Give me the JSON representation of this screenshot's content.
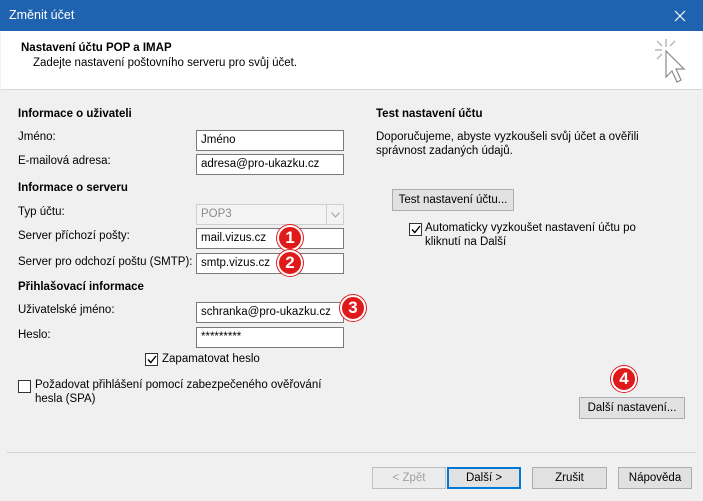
{
  "window": {
    "title": "Změnit účet"
  },
  "header": {
    "title": "Nastavení účtu POP a IMAP",
    "subtitle": "Zadejte nastavení poštovního serveru pro svůj účet."
  },
  "user_info": {
    "heading": "Informace o uživateli",
    "name_label": "Jméno:",
    "name_value": "Jméno",
    "email_label": "E-mailová adresa:",
    "email_value": "adresa@pro-ukazku.cz"
  },
  "server_info": {
    "heading": "Informace o serveru",
    "account_type_label": "Typ účtu:",
    "account_type_value": "POP3",
    "incoming_label": "Server příchozí pošty:",
    "incoming_value": "mail.vizus.cz",
    "outgoing_label": "Server pro odchozí poštu (SMTP):",
    "outgoing_value": "smtp.vizus.cz"
  },
  "login_info": {
    "heading": "Přihlašovací informace",
    "username_label": "Uživatelské jméno:",
    "username_value": "schranka@pro-ukazku.cz",
    "password_label": "Heslo:",
    "password_value": "*********",
    "remember_label": "Zapamatovat heslo",
    "remember_checked": true,
    "spa_label_line1": "Požadovat přihlášení pomocí zabezpečeného ověřování",
    "spa_label_line2": "hesla (SPA)",
    "spa_checked": false
  },
  "test_section": {
    "heading": "Test nastavení účtu",
    "desc_line1": "Doporučujeme, abyste vyzkoušeli svůj účet a ověřili",
    "desc_line2": "správnost zadaných údajů.",
    "test_button": "Test nastavení účtu...",
    "auto_test_line1": "Automaticky vyzkoušet nastavení účtu po",
    "auto_test_line2": "kliknutí na Další",
    "auto_test_checked": true
  },
  "more_settings_button": "Další nastavení...",
  "badges": [
    "1",
    "2",
    "3",
    "4"
  ],
  "footer": {
    "back_button": "< Zpět",
    "next_button": "Další >",
    "cancel_button": "Zrušit",
    "help_button": "Nápověda"
  },
  "colors": {
    "titlebar": "#1f62b0",
    "badge": "#e0191b",
    "focus": "#0078d7"
  }
}
